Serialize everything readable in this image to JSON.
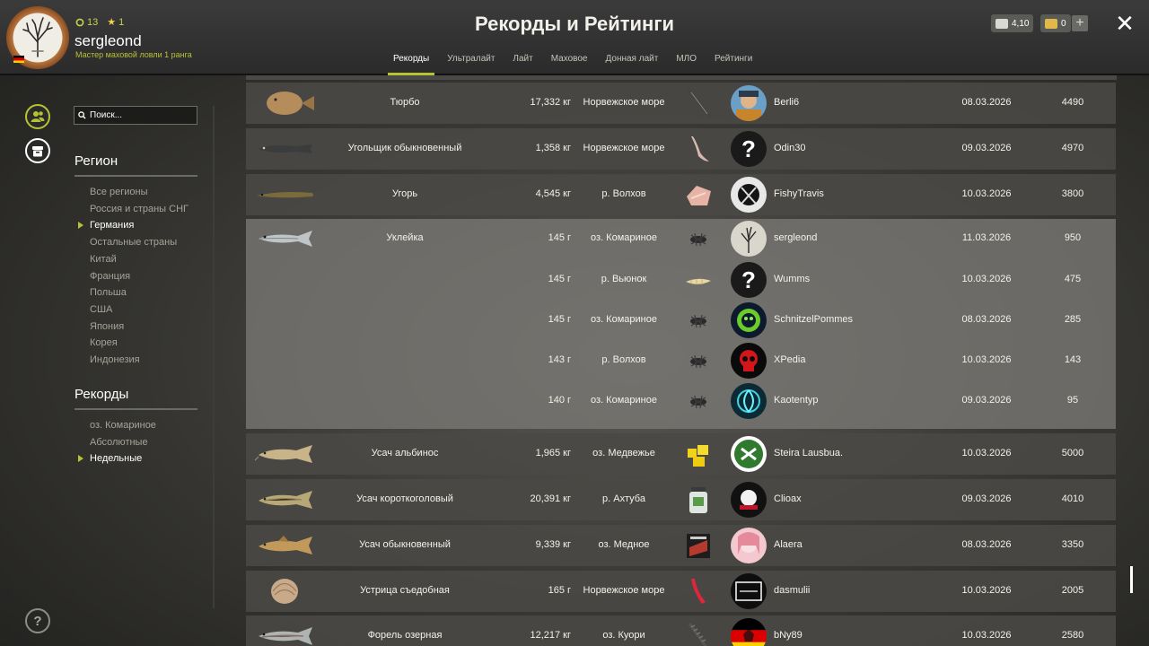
{
  "window": {
    "title": "Рекорды и Рейтинги",
    "close_label": "✕"
  },
  "user": {
    "name": "sergleond",
    "rank_title": "Мастер маховой ловли 1 ранга",
    "level": "13",
    "stars": "1",
    "flag": "germany-flag"
  },
  "currency": {
    "silver": "4,10",
    "gold": "0",
    "add_label": "+"
  },
  "tabs": [
    {
      "label": "Рекорды",
      "active": true
    },
    {
      "label": "Ультралайт",
      "active": false
    },
    {
      "label": "Лайт",
      "active": false
    },
    {
      "label": "Маховое",
      "active": false
    },
    {
      "label": "Донная лайт",
      "active": false
    },
    {
      "label": "МЛО",
      "active": false
    },
    {
      "label": "Рейтинги",
      "active": false
    }
  ],
  "search": {
    "placeholder": "Поиск..."
  },
  "region": {
    "title": "Регион",
    "items": [
      "Все регионы",
      "Россия и страны СНГ",
      "Германия",
      "Остальные страны",
      "Китай",
      "Франция",
      "Польша",
      "США",
      "Япония",
      "Корея",
      "Индонезия"
    ],
    "selected": "Германия"
  },
  "records_filter": {
    "title": "Рекорды",
    "items": [
      "оз. Комариное",
      "Абсолютные",
      "Недельные"
    ],
    "selected": "Недельные"
  },
  "help_label": "?",
  "records": [
    {
      "fish": "Тюрбо",
      "entries": [
        {
          "weight": "17,332 кг",
          "location": "Норвежское море",
          "bait": "jig-lure-icon",
          "player": "Berli6",
          "date": "08.03.2026",
          "score": "4490"
        }
      ]
    },
    {
      "fish": "Угольщик обыкновенный",
      "entries": [
        {
          "weight": "1,358 кг",
          "location": "Норвежское море",
          "bait": "pink-shad-lure-icon",
          "player": "Odin30",
          "date": "09.03.2026",
          "score": "4970"
        }
      ]
    },
    {
      "fish": "Угорь",
      "entries": [
        {
          "weight": "4,545 кг",
          "location": "р. Волхов",
          "bait": "fish-meat-bait-icon",
          "player": "FishyTravis",
          "date": "10.03.2026",
          "score": "3800"
        }
      ]
    },
    {
      "fish": "Уклейка",
      "entries": [
        {
          "weight": "145 г",
          "location": "оз. Комариное",
          "bait": "insect-bait-icon",
          "player": "sergleond",
          "date": "11.03.2026",
          "score": "950"
        },
        {
          "weight": "145 г",
          "location": "р. Вьюнок",
          "bait": "maggot-bait-icon",
          "player": "Wumms",
          "date": "10.03.2026",
          "score": "475"
        },
        {
          "weight": "145 г",
          "location": "оз. Комариное",
          "bait": "insect-bait-icon",
          "player": "SchnitzelPommes",
          "date": "08.03.2026",
          "score": "285"
        },
        {
          "weight": "143 г",
          "location": "р. Волхов",
          "bait": "insect-bait-icon",
          "player": "XPedia",
          "date": "10.03.2026",
          "score": "143"
        },
        {
          "weight": "140 г",
          "location": "оз. Комариное",
          "bait": "insect-bait-icon",
          "player": "Kaotentyp",
          "date": "09.03.2026",
          "score": "95"
        }
      ]
    },
    {
      "fish": "Усач альбинос",
      "entries": [
        {
          "weight": "1,965 кг",
          "location": "оз. Медвежье",
          "bait": "cheese-bait-icon",
          "player": "Steira Lausbua.",
          "date": "10.03.2026",
          "score": "5000"
        }
      ]
    },
    {
      "fish": "Усач короткоголовый",
      "entries": [
        {
          "weight": "20,391 кг",
          "location": "р. Ахтуба",
          "bait": "paste-jar-bait-icon",
          "player": "Clioax",
          "date": "09.03.2026",
          "score": "4010"
        }
      ]
    },
    {
      "fish": "Усач обыкновенный",
      "entries": [
        {
          "weight": "9,339 кг",
          "location": "оз. Медное",
          "bait": "groundbait-pack-icon",
          "player": "Alaera",
          "date": "08.03.2026",
          "score": "3350"
        }
      ]
    },
    {
      "fish": "Устрица съедобная",
      "entries": [
        {
          "weight": "165 г",
          "location": "Норвежское море",
          "bait": "red-soft-lure-icon",
          "player": "dasmulii",
          "date": "10.03.2026",
          "score": "2005"
        }
      ]
    },
    {
      "fish": "Форель озерная",
      "entries": [
        {
          "weight": "12,217 кг",
          "location": "оз. Куори",
          "bait": "spoon-lure-icon",
          "player": "bNy89",
          "date": "10.03.2026",
          "score": "2580"
        }
      ]
    }
  ]
}
